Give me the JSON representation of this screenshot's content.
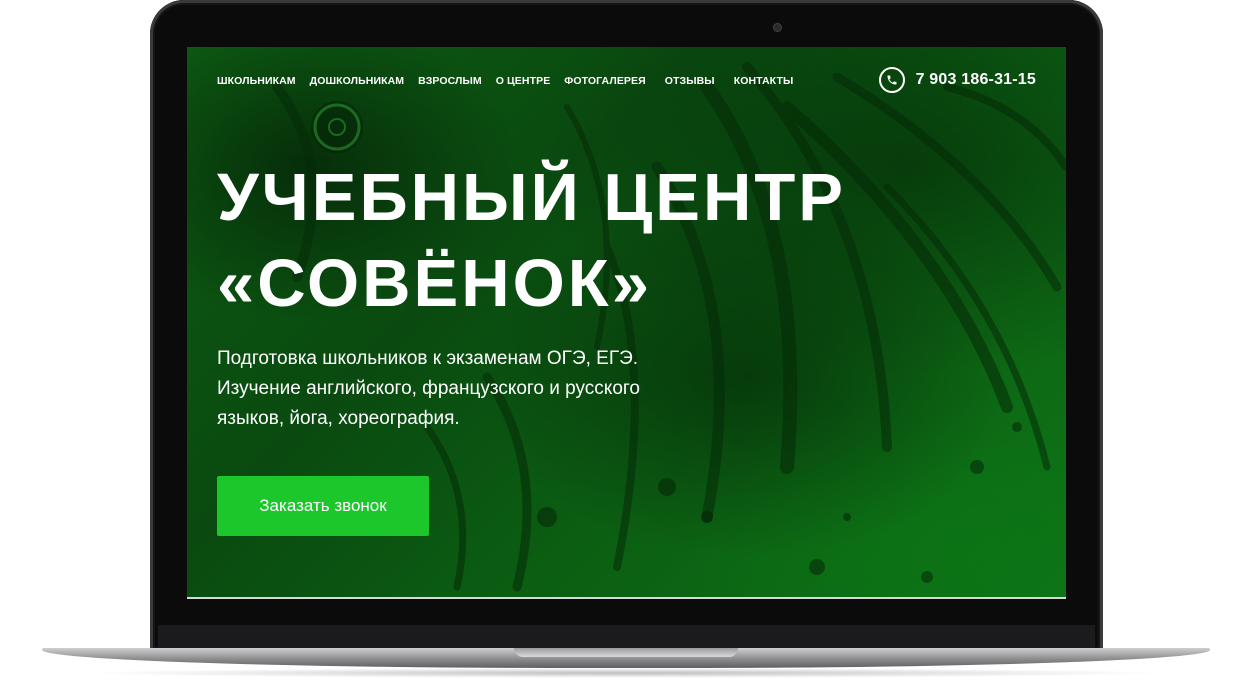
{
  "nav": {
    "items": [
      {
        "label": "ШКОЛЬНИКАМ"
      },
      {
        "label": "ДОШКОЛЬНИКАМ"
      },
      {
        "label": "ВЗРОСЛЫМ"
      },
      {
        "label": "О ЦЕНТРЕ"
      },
      {
        "label": "ФОТОГАЛЕРЕЯ"
      },
      {
        "label": "ОТЗЫВЫ"
      },
      {
        "label": "КОНТАКТЫ"
      }
    ]
  },
  "contact": {
    "phone": "7 903 186-31-15",
    "icon": "phone-icon"
  },
  "hero": {
    "title_line1": "УЧЕБНЫЙ ЦЕНТР",
    "title_line2": "«СОВЁНОК»",
    "subtitle_line1": "Подготовка школьников к экзаменам ОГЭ, ЕГЭ.",
    "subtitle_line2": "Изучение английского, французского и русского",
    "subtitle_line3": "языков, йога, хореография.",
    "cta_label": "Заказать звонок"
  },
  "colors": {
    "background": "#0b5d12",
    "accent": "#1bc72a",
    "text": "#ffffff"
  }
}
